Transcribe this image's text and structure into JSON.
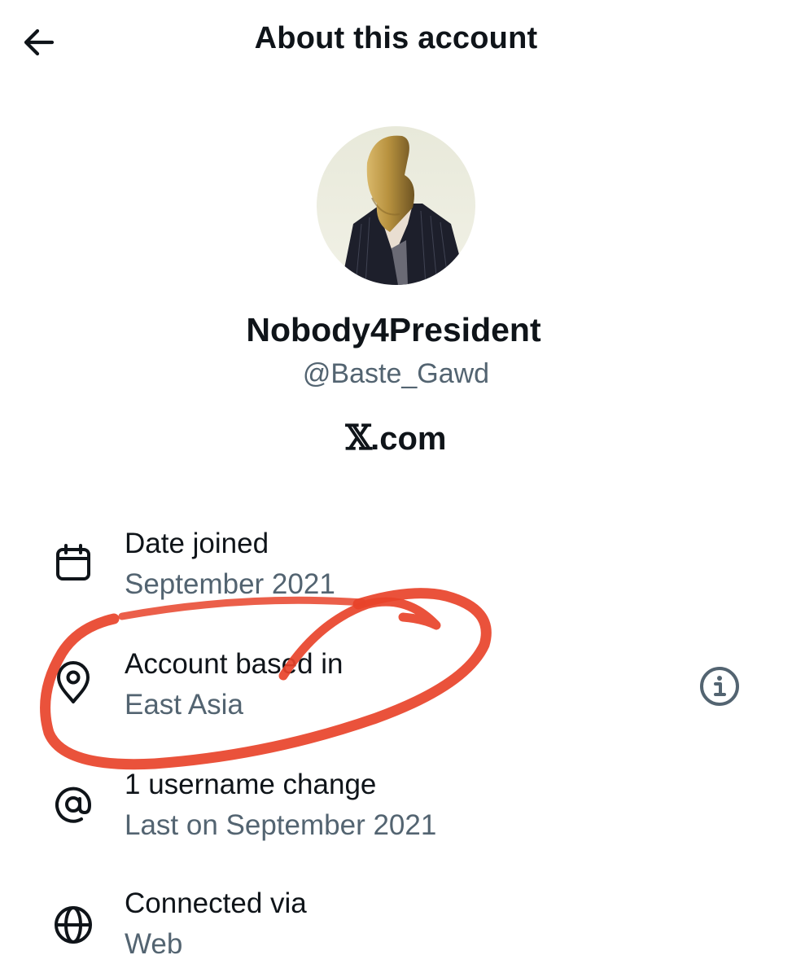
{
  "header": {
    "title": "About this account",
    "back_icon": "arrow-left-icon"
  },
  "profile": {
    "display_name": "Nobody4President",
    "handle": "@Baste_Gawd",
    "platform_glyph": "𝕏",
    "platform_suffix": ".com"
  },
  "rows": [
    {
      "icon": "calendar-icon",
      "label": "Date joined",
      "value": "September 2021"
    },
    {
      "icon": "location-pin-icon",
      "label": "Account based in",
      "value": "East Asia",
      "has_info": true
    },
    {
      "icon": "at-sign-icon",
      "label": "1 username change",
      "value": "Last on September 2021"
    },
    {
      "icon": "globe-icon",
      "label": "Connected via",
      "value": "Web"
    }
  ],
  "colors": {
    "text_primary": "#0f1419",
    "text_secondary": "#536471",
    "annotation_red": "#e8432a"
  }
}
